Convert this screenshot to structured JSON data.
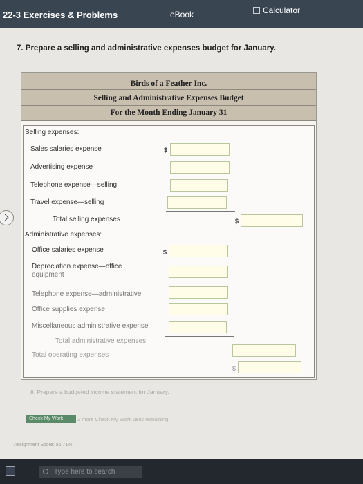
{
  "topbar": {
    "title": "22-3 Exercises & Problems",
    "ebook_tab": "eBook",
    "calculator": "Calculator"
  },
  "question": "7. Prepare a selling and administrative expenses budget for January.",
  "budget": {
    "company": "Birds of a Feather Inc.",
    "title": "Selling and Administrative Expenses Budget",
    "period": "For the Month Ending January 31",
    "selling_expenses": "Selling expenses:",
    "sales_salaries": "Sales salaries expense",
    "advertising": "Advertising expense",
    "telephone_selling": "Telephone expense—selling",
    "travel_selling": "Travel expense—selling",
    "total_selling": "Total selling expenses",
    "admin_expenses": "Administrative expenses:",
    "office_salaries": "Office salaries expense",
    "depreciation_line1": "Depreciation expense—office",
    "depreciation_line2": "equipment",
    "telephone_admin": "Telephone expense—administrative",
    "office_supplies": "Office supplies expense",
    "misc_admin": "Miscellaneous administrative expense",
    "total_admin": "Total administrative expenses",
    "total_operating": "Total operating expenses",
    "currency": "$"
  },
  "part8": "8. Prepare a budgeted income statement for January.",
  "check_button": "Check My Work",
  "check_note": "2 more Check My Work uses remaining",
  "assignment_score": "Assignment Score: 56.71%",
  "taskbar": {
    "search_placeholder": "Type here to search"
  }
}
